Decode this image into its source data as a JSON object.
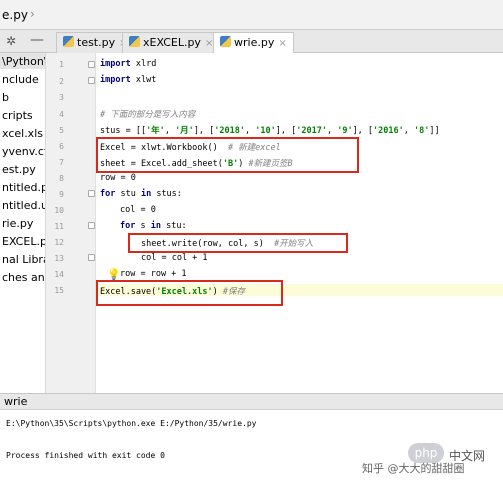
{
  "breadcrumb": {
    "file": "e.py"
  },
  "tabs": [
    {
      "label": "test.py",
      "active": false
    },
    {
      "label": "xEXCEL.py",
      "active": false
    },
    {
      "label": "wrie.py",
      "active": true
    }
  ],
  "project_items": [
    "\\Python\\",
    "nclude",
    "b",
    "cripts",
    "xcel.xls",
    "yvenv.cfg",
    "est.py",
    "ntitled.py",
    "ntitled.ui",
    "rie.py",
    "EXCEL.py",
    "nal Libra",
    "ches and"
  ],
  "line_numbers": [
    "1",
    "2",
    "3",
    "4",
    "5",
    "6",
    "7",
    "8",
    "9",
    "10",
    "11",
    "12",
    "13",
    "14",
    "15"
  ],
  "code": {
    "l1_kw": "import",
    "l1_rest": " xlrd",
    "l2_kw": "import",
    "l2_rest": " xlwt",
    "l4": "# 下面的部分是写入内容",
    "l5_a": "stus = [[",
    "l5_s1": "'年'",
    "l5_c1": ", ",
    "l5_s2": "'月'",
    "l5_b": "], [",
    "l5_s3": "'2018'",
    "l5_c2": ", ",
    "l5_s4": "'10'",
    "l5_d": "], [",
    "l5_s5": "'2017'",
    "l5_c3": ", ",
    "l5_s6": "'9'",
    "l5_e": "], [",
    "l5_s7": "'2016'",
    "l5_c4": ", ",
    "l5_s8": "'8'",
    "l5_f": "]]",
    "l6_code": "Excel = xlwt.Workbook()  ",
    "l6_cmt": "# 新建excel",
    "l7_a": "sheet = Excel.add_sheet(",
    "l7_s": "'B'",
    "l7_b": ") ",
    "l7_cmt": "#新建页签B",
    "l8": "row = 0",
    "l9_kw1": "for",
    "l9_mid": " stu ",
    "l9_kw2": "in",
    "l9_rest": " stus:",
    "l10": "col = 0",
    "l11_kw1": "for",
    "l11_mid": " s ",
    "l11_kw2": "in",
    "l11_rest": " stu:",
    "l12_code": "sheet.write(row, col, s)  ",
    "l12_cmt": "#开始写入",
    "l13": "col = col + 1",
    "l14": "row = row + 1",
    "l15_a": "Excel.save(",
    "l15_s": "'Excel.xls'",
    "l15_b": ") ",
    "l15_cmt": "#保存"
  },
  "run": {
    "tab": "wrie",
    "command": "E:\\Python\\35\\Scripts\\python.exe E:/Python/35/wrie.py",
    "exit": "Process finished with exit code 0"
  },
  "watermark": {
    "php": "php",
    "cn": "中文网",
    "zhihu": "知乎 @大大的甜甜圈"
  },
  "colors": {
    "highlight_box": "#d9281c",
    "keyword": "#000080",
    "string": "#008000",
    "comment": "#808080"
  }
}
